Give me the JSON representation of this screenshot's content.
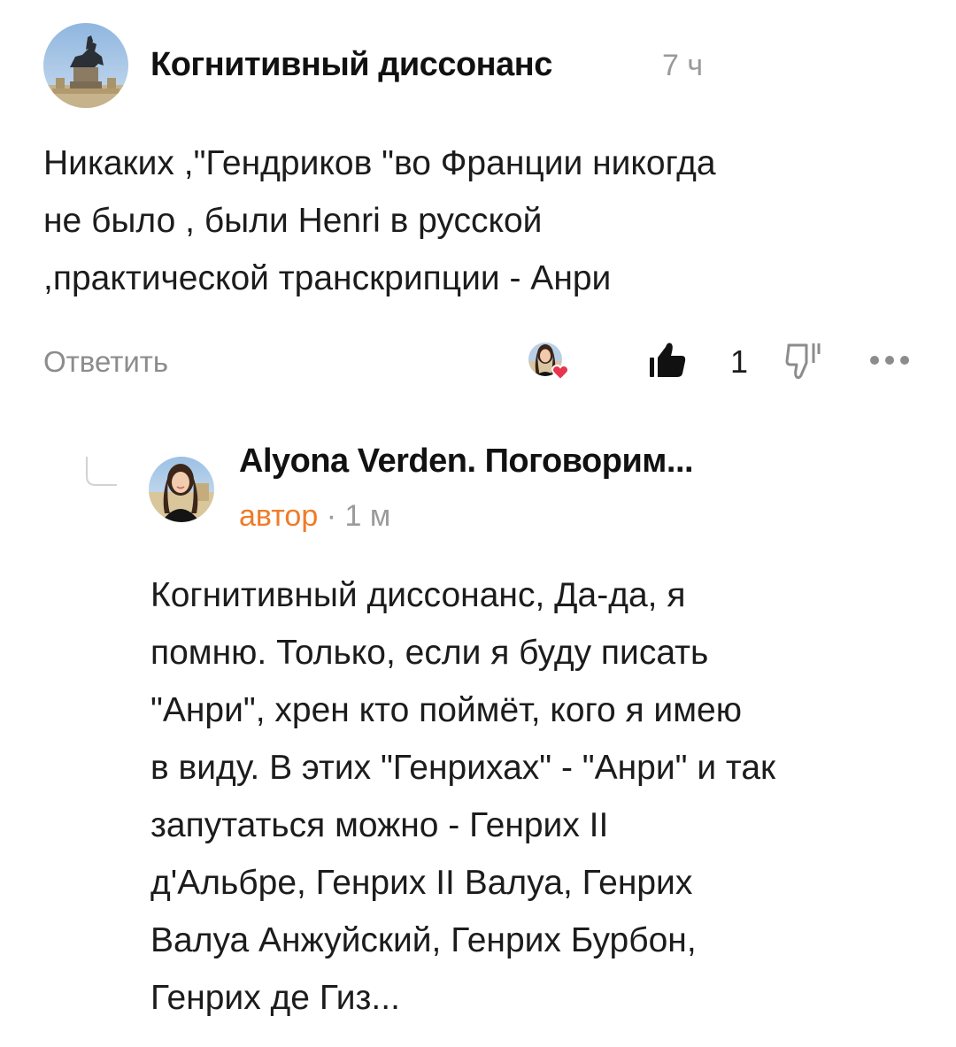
{
  "comment": {
    "author": "Когнитивный диссонанс",
    "time": "7 ч",
    "avatar_icon": "horse-statue-avatar",
    "text": "Никаких ,\"Гендриков \"во Франции никогда\nне было , были Henri в русской\n,практической транскрипции - Анри",
    "actions": {
      "reply_label": "Ответить",
      "like_count": "1",
      "liker_avatar_icon": "liker-avatar-heart",
      "like_icon": "thumbs-up-icon",
      "dislike_icon": "thumbs-down-icon",
      "more_icon": "more-dots-icon"
    }
  },
  "reply": {
    "author": "Alyona Verden. Поговорим...",
    "role": "автор",
    "separator": "·",
    "time": "1 м",
    "avatar_icon": "woman-portrait-avatar",
    "text": "Когнитивный диссонанс, Да-да, я\nпомню. Только, если я буду писать\n\"Анри\", хрен кто поймёт, кого я имею\nв виду. В этих \"Генрихах\" - \"Анри\" и так\nзапутаться можно - Генрих II\nд'Альбре, Генрих II Валуа, Генрих\nВалуа Анжуйский, Генрих Бурбон,\nГенрих де Гиз..."
  },
  "colors": {
    "author_role": "#f07b28",
    "muted": "#9a9a9a",
    "heart": "#e8344e"
  }
}
